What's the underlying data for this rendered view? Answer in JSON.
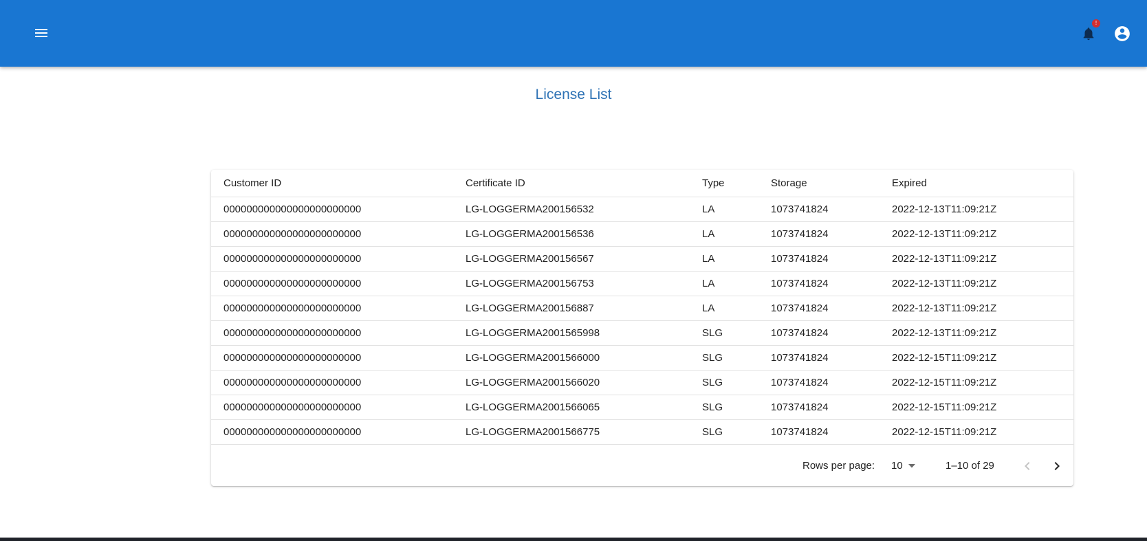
{
  "app_bar": {
    "menu_icon": "menu-icon",
    "notification_icon": "bell-icon",
    "notification_badge": "!",
    "account_icon": "account-circle-icon",
    "background_color": "#1976d2"
  },
  "page": {
    "title": "License List",
    "title_color": "#2f73b5"
  },
  "table": {
    "columns": [
      "Customer ID",
      "Certificate ID",
      "Type",
      "Storage",
      "Expired"
    ],
    "rows": [
      [
        "000000000000000000000000",
        "LG-LOGGERMA200156532",
        "LA",
        "1073741824",
        "2022-12-13T11:09:21Z"
      ],
      [
        "000000000000000000000000",
        "LG-LOGGERMA200156536",
        "LA",
        "1073741824",
        "2022-12-13T11:09:21Z"
      ],
      [
        "000000000000000000000000",
        "LG-LOGGERMA200156567",
        "LA",
        "1073741824",
        "2022-12-13T11:09:21Z"
      ],
      [
        "000000000000000000000000",
        "LG-LOGGERMA200156753",
        "LA",
        "1073741824",
        "2022-12-13T11:09:21Z"
      ],
      [
        "000000000000000000000000",
        "LG-LOGGERMA200156887",
        "LA",
        "1073741824",
        "2022-12-13T11:09:21Z"
      ],
      [
        "000000000000000000000000",
        "LG-LOGGERMA2001565998",
        "SLG",
        "1073741824",
        "2022-12-13T11:09:21Z"
      ],
      [
        "000000000000000000000000",
        "LG-LOGGERMA2001566000",
        "SLG",
        "1073741824",
        "2022-12-15T11:09:21Z"
      ],
      [
        "000000000000000000000000",
        "LG-LOGGERMA2001566020",
        "SLG",
        "1073741824",
        "2022-12-15T11:09:21Z"
      ],
      [
        "000000000000000000000000",
        "LG-LOGGERMA2001566065",
        "SLG",
        "1073741824",
        "2022-12-15T11:09:21Z"
      ],
      [
        "000000000000000000000000",
        "LG-LOGGERMA2001566775",
        "SLG",
        "1073741824",
        "2022-12-15T11:09:21Z"
      ]
    ]
  },
  "pagination": {
    "rows_per_page_label": "Rows per page:",
    "rows_per_page_value": "10",
    "range_text": "1–10 of 29",
    "prev_icon": "chevron-left-icon",
    "next_icon": "chevron-right-icon"
  }
}
